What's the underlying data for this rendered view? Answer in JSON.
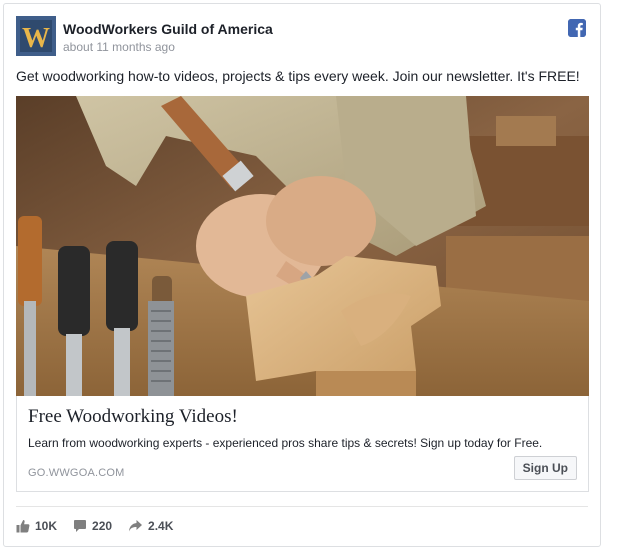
{
  "page": {
    "name": "WoodWorkers Guild of America",
    "timestamp": "about 11 months ago",
    "logo_letter": "W"
  },
  "post": {
    "text": "Get woodworking how-to videos, projects & tips every week. Join our newsletter. It's FREE!"
  },
  "link_preview": {
    "title": "Free Woodworking Videos!",
    "description": "Learn from woodworking experts - experienced pros share tips & secrets! Sign up today for Free.",
    "domain": "GO.WWGOA.COM",
    "cta_label": "Sign Up"
  },
  "stats": {
    "likes": "10K",
    "comments": "220",
    "shares": "2.4K"
  },
  "colors": {
    "brand": "#4267b2",
    "logo_bg": "#3f5e8a",
    "logo_letter": "#e8b64a",
    "muted_text": "#90949c"
  },
  "icons": {
    "facebook": "facebook-icon",
    "like": "thumbs-up-icon",
    "comment": "comment-icon",
    "share": "share-icon"
  }
}
